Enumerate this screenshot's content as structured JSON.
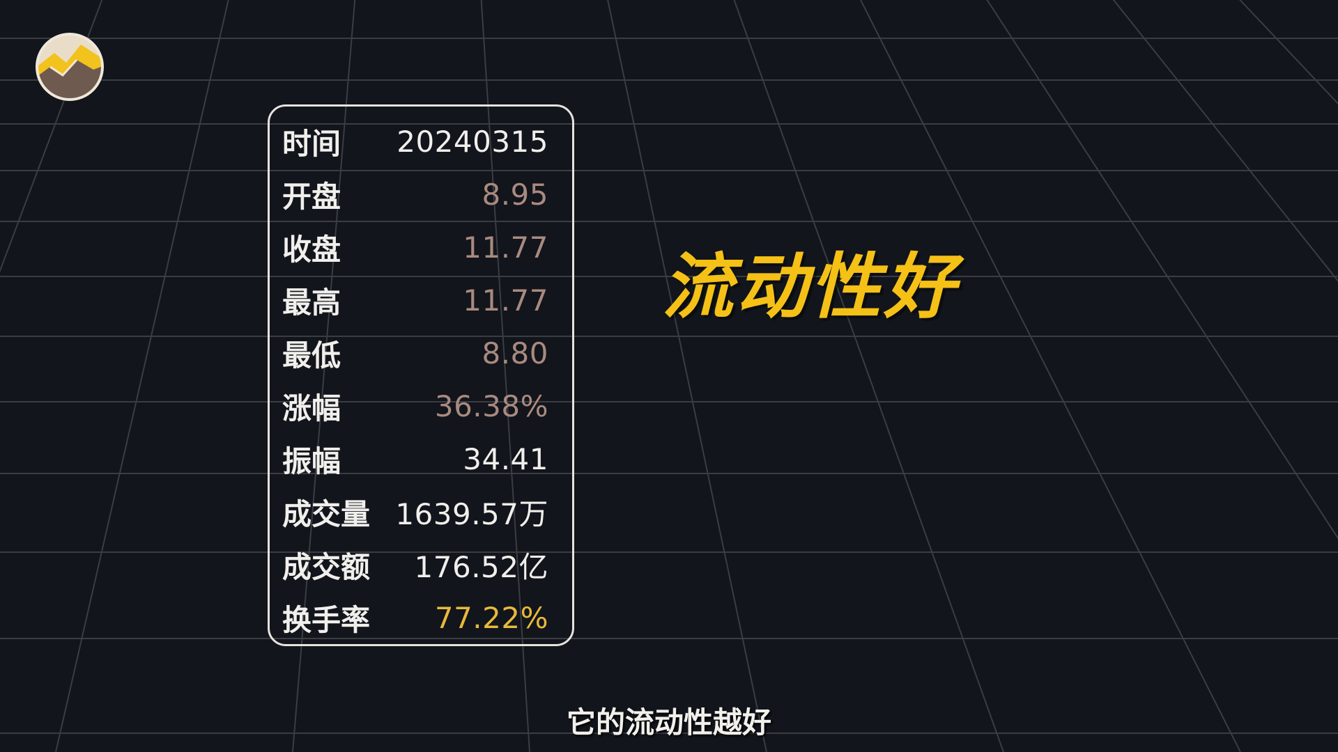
{
  "stats": [
    {
      "label": "时间",
      "value": "20240315"
    },
    {
      "label": "开盘",
      "value": "8.95"
    },
    {
      "label": "收盘",
      "value": "11.77"
    },
    {
      "label": "最高",
      "value": "11.77"
    },
    {
      "label": "最低",
      "value": "8.80"
    },
    {
      "label": "涨幅",
      "value": "36.38%"
    },
    {
      "label": "振幅",
      "value": "34.41"
    },
    {
      "label": "成交量",
      "value": "1639.57万"
    },
    {
      "label": "成交额",
      "value": "176.52亿"
    },
    {
      "label": "换手率",
      "value": "77.22%"
    }
  ],
  "headline": "流动性好",
  "subtitle": "它的流动性越好",
  "colors": {
    "background": "#12151b",
    "grid_line": "#3a3d42",
    "headline": "#f5c117",
    "price_value": "#a98a80",
    "highlight_value": "#e8b93c",
    "card_border": "#e6e3df"
  },
  "logo_icon": "mountain-logo-icon"
}
